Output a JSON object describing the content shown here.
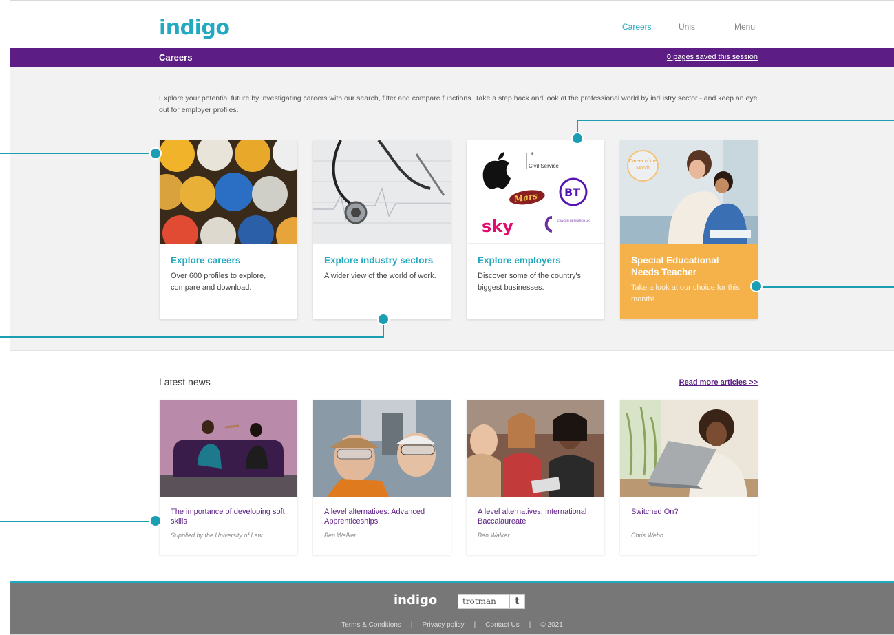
{
  "header": {
    "logo": "indigo",
    "nav": [
      "Careers",
      "Unis",
      "Menu"
    ]
  },
  "bar": {
    "title": "Careers",
    "saved_count": "0",
    "saved_text": " pages saved this session"
  },
  "intro": "Explore your potential future by investigating careers with our search, filter and compare functions. Take a step back and look at the professional world by industry sector - and keep an eye out for employer profiles.",
  "cards": [
    {
      "title": "Explore careers",
      "desc": "Over 600 profiles to explore, compare and download."
    },
    {
      "title": "Explore industry sectors",
      "desc": "A wider view of the world of work."
    },
    {
      "title": "Explore employers",
      "desc": "Discover some of the country's biggest businesses."
    },
    {
      "title": "Special Educational Needs Teacher",
      "desc": "Take a look at our choice for this month!",
      "badge": "Career of the Month"
    }
  ],
  "employer_logos": [
    "Civil Service",
    "Mars",
    "BT",
    "sky",
    "CANCER RESEARCH UK"
  ],
  "news": {
    "heading": "Latest news",
    "read_more": "Read more articles >>",
    "items": [
      {
        "title": "The importance of developing soft skills",
        "author": "Supplied by the University of Law"
      },
      {
        "title": "A level alternatives: Advanced Apprenticeships",
        "author": "Ben Walker"
      },
      {
        "title": "A level alternatives: International Baccalaureate",
        "author": "Ben Walker"
      },
      {
        "title": "Switched On?",
        "author": "Chris Webb"
      }
    ]
  },
  "footer": {
    "logo": "indigo",
    "partner_word": "trotman",
    "partner_mark": "t",
    "links": [
      "Terms & Conditions",
      "Privacy policy",
      "Contact Us",
      "© 2021"
    ]
  },
  "colors": {
    "brand": "#22a8bf",
    "purple": "#5c1e84",
    "featured": "#f6b24a",
    "callout": "#1b9eb4"
  }
}
